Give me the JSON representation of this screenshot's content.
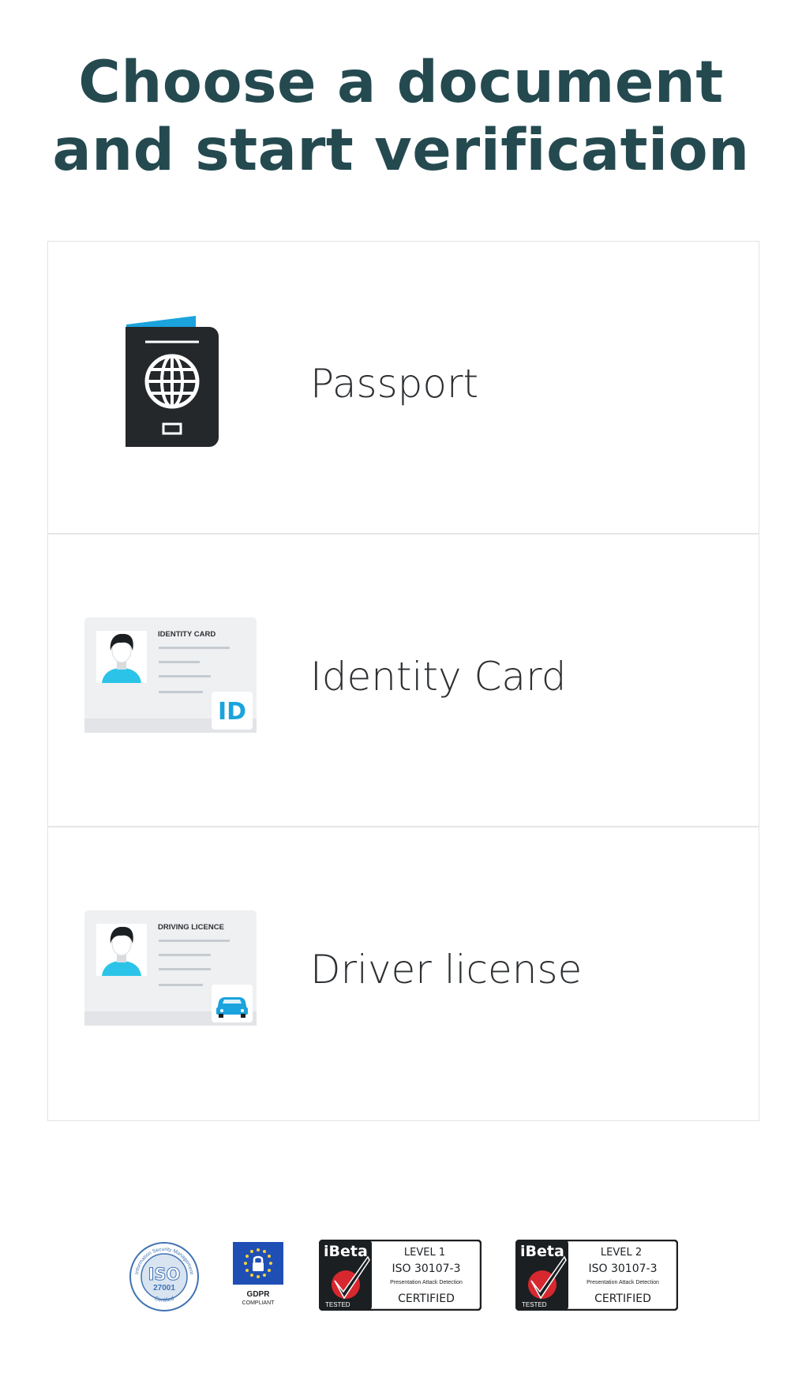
{
  "page": {
    "title_line1": "Choose a document",
    "title_line2": "and start verification"
  },
  "documents": [
    {
      "label": "Passport",
      "icon": "passport-icon"
    },
    {
      "label": "Identity Card",
      "icon": "id-card-icon",
      "card_header": "IDENTITY CARD",
      "badge_text": "ID"
    },
    {
      "label": "Driver license",
      "icon": "driving-licence-icon",
      "card_header": "DRIVING LICENCE"
    }
  ],
  "certifications": {
    "iso": {
      "top": "Information Security Management",
      "main": "ISO",
      "number": "27001",
      "bottom": "Certified"
    },
    "gdpr": {
      "main": "GDPR",
      "sub": "COMPLIANT"
    },
    "ibeta1": {
      "brand": "iBeta",
      "level": "LEVEL 1",
      "standard": "ISO 30107-3",
      "desc": "Presentation Attack Detection",
      "tested": "TESTED",
      "certified": "CERTIFIED"
    },
    "ibeta2": {
      "brand": "iBeta",
      "level": "LEVEL 2",
      "standard": "ISO 30107-3",
      "desc": "Presentation Attack Detection",
      "tested": "TESTED",
      "certified": "CERTIFIED"
    }
  },
  "colors": {
    "title": "#244a50",
    "accent_blue": "#1aa3dd",
    "passport_cover": "#25282b",
    "avatar_shirt": "#2bc4e8",
    "card_bg": "#eef0f2",
    "ibeta_red": "#d7282f",
    "eu_blue": "#1f4fb5"
  }
}
